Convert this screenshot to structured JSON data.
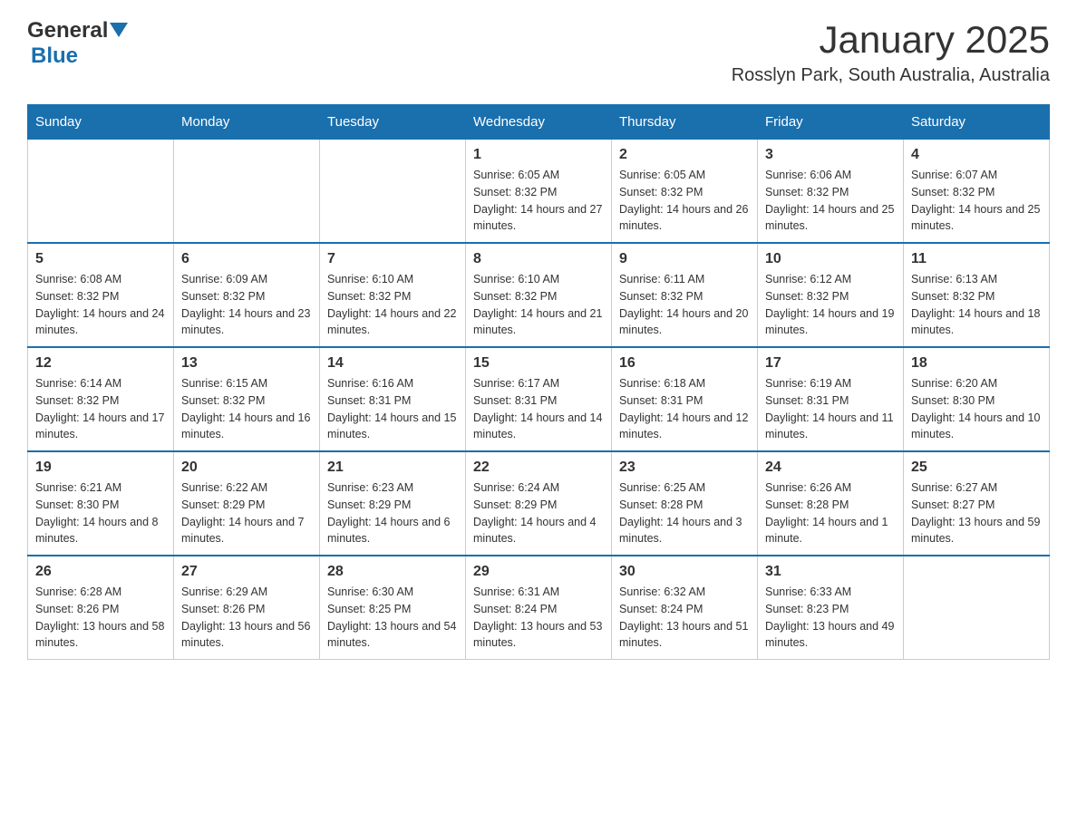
{
  "header": {
    "logo": {
      "text_general": "General",
      "text_blue": "Blue",
      "icon": "▶"
    },
    "title": "January 2025",
    "subtitle": "Rosslyn Park, South Australia, Australia"
  },
  "calendar": {
    "days_of_week": [
      "Sunday",
      "Monday",
      "Tuesday",
      "Wednesday",
      "Thursday",
      "Friday",
      "Saturday"
    ],
    "weeks": [
      {
        "days": [
          {
            "number": "",
            "info": ""
          },
          {
            "number": "",
            "info": ""
          },
          {
            "number": "",
            "info": ""
          },
          {
            "number": "1",
            "info": "Sunrise: 6:05 AM\nSunset: 8:32 PM\nDaylight: 14 hours and 27 minutes."
          },
          {
            "number": "2",
            "info": "Sunrise: 6:05 AM\nSunset: 8:32 PM\nDaylight: 14 hours and 26 minutes."
          },
          {
            "number": "3",
            "info": "Sunrise: 6:06 AM\nSunset: 8:32 PM\nDaylight: 14 hours and 25 minutes."
          },
          {
            "number": "4",
            "info": "Sunrise: 6:07 AM\nSunset: 8:32 PM\nDaylight: 14 hours and 25 minutes."
          }
        ]
      },
      {
        "days": [
          {
            "number": "5",
            "info": "Sunrise: 6:08 AM\nSunset: 8:32 PM\nDaylight: 14 hours and 24 minutes."
          },
          {
            "number": "6",
            "info": "Sunrise: 6:09 AM\nSunset: 8:32 PM\nDaylight: 14 hours and 23 minutes."
          },
          {
            "number": "7",
            "info": "Sunrise: 6:10 AM\nSunset: 8:32 PM\nDaylight: 14 hours and 22 minutes."
          },
          {
            "number": "8",
            "info": "Sunrise: 6:10 AM\nSunset: 8:32 PM\nDaylight: 14 hours and 21 minutes."
          },
          {
            "number": "9",
            "info": "Sunrise: 6:11 AM\nSunset: 8:32 PM\nDaylight: 14 hours and 20 minutes."
          },
          {
            "number": "10",
            "info": "Sunrise: 6:12 AM\nSunset: 8:32 PM\nDaylight: 14 hours and 19 minutes."
          },
          {
            "number": "11",
            "info": "Sunrise: 6:13 AM\nSunset: 8:32 PM\nDaylight: 14 hours and 18 minutes."
          }
        ]
      },
      {
        "days": [
          {
            "number": "12",
            "info": "Sunrise: 6:14 AM\nSunset: 8:32 PM\nDaylight: 14 hours and 17 minutes."
          },
          {
            "number": "13",
            "info": "Sunrise: 6:15 AM\nSunset: 8:32 PM\nDaylight: 14 hours and 16 minutes."
          },
          {
            "number": "14",
            "info": "Sunrise: 6:16 AM\nSunset: 8:31 PM\nDaylight: 14 hours and 15 minutes."
          },
          {
            "number": "15",
            "info": "Sunrise: 6:17 AM\nSunset: 8:31 PM\nDaylight: 14 hours and 14 minutes."
          },
          {
            "number": "16",
            "info": "Sunrise: 6:18 AM\nSunset: 8:31 PM\nDaylight: 14 hours and 12 minutes."
          },
          {
            "number": "17",
            "info": "Sunrise: 6:19 AM\nSunset: 8:31 PM\nDaylight: 14 hours and 11 minutes."
          },
          {
            "number": "18",
            "info": "Sunrise: 6:20 AM\nSunset: 8:30 PM\nDaylight: 14 hours and 10 minutes."
          }
        ]
      },
      {
        "days": [
          {
            "number": "19",
            "info": "Sunrise: 6:21 AM\nSunset: 8:30 PM\nDaylight: 14 hours and 8 minutes."
          },
          {
            "number": "20",
            "info": "Sunrise: 6:22 AM\nSunset: 8:29 PM\nDaylight: 14 hours and 7 minutes."
          },
          {
            "number": "21",
            "info": "Sunrise: 6:23 AM\nSunset: 8:29 PM\nDaylight: 14 hours and 6 minutes."
          },
          {
            "number": "22",
            "info": "Sunrise: 6:24 AM\nSunset: 8:29 PM\nDaylight: 14 hours and 4 minutes."
          },
          {
            "number": "23",
            "info": "Sunrise: 6:25 AM\nSunset: 8:28 PM\nDaylight: 14 hours and 3 minutes."
          },
          {
            "number": "24",
            "info": "Sunrise: 6:26 AM\nSunset: 8:28 PM\nDaylight: 14 hours and 1 minute."
          },
          {
            "number": "25",
            "info": "Sunrise: 6:27 AM\nSunset: 8:27 PM\nDaylight: 13 hours and 59 minutes."
          }
        ]
      },
      {
        "days": [
          {
            "number": "26",
            "info": "Sunrise: 6:28 AM\nSunset: 8:26 PM\nDaylight: 13 hours and 58 minutes."
          },
          {
            "number": "27",
            "info": "Sunrise: 6:29 AM\nSunset: 8:26 PM\nDaylight: 13 hours and 56 minutes."
          },
          {
            "number": "28",
            "info": "Sunrise: 6:30 AM\nSunset: 8:25 PM\nDaylight: 13 hours and 54 minutes."
          },
          {
            "number": "29",
            "info": "Sunrise: 6:31 AM\nSunset: 8:24 PM\nDaylight: 13 hours and 53 minutes."
          },
          {
            "number": "30",
            "info": "Sunrise: 6:32 AM\nSunset: 8:24 PM\nDaylight: 13 hours and 51 minutes."
          },
          {
            "number": "31",
            "info": "Sunrise: 6:33 AM\nSunset: 8:23 PM\nDaylight: 13 hours and 49 minutes."
          },
          {
            "number": "",
            "info": ""
          }
        ]
      }
    ]
  }
}
